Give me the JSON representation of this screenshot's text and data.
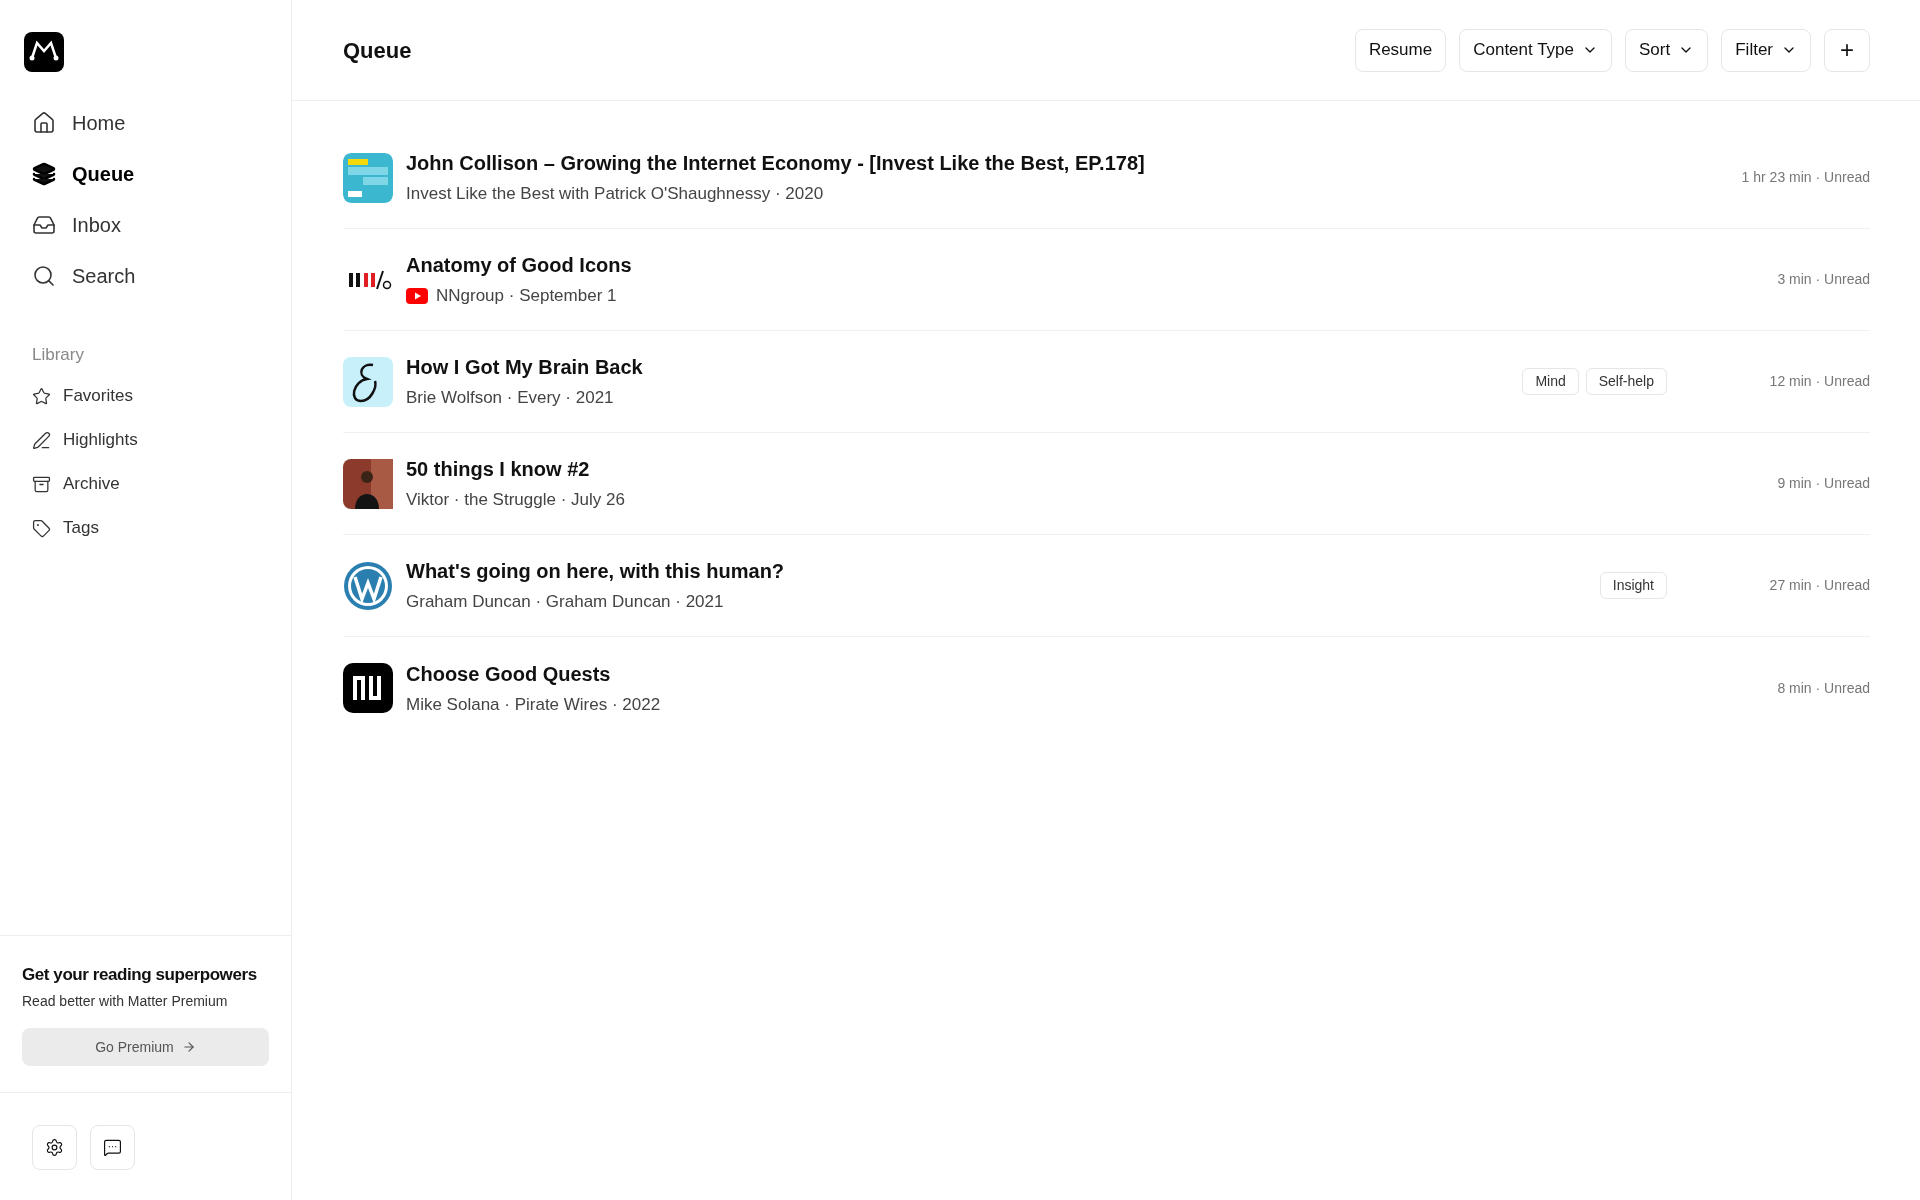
{
  "nav": [
    {
      "label": "Home",
      "selected": false
    },
    {
      "label": "Queue",
      "selected": true
    },
    {
      "label": "Inbox",
      "selected": false
    },
    {
      "label": "Search",
      "selected": false
    }
  ],
  "library": {
    "heading": "Library",
    "items": [
      "Favorites",
      "Highlights",
      "Archive",
      "Tags"
    ]
  },
  "promo": {
    "title": "Get your reading superpowers",
    "text": "Read better with Matter Premium",
    "button": "Go Premium"
  },
  "header": {
    "title": "Queue",
    "buttons": [
      {
        "label": "Resume",
        "kind": "plain"
      },
      {
        "label": "Content Type",
        "kind": "dropdown"
      },
      {
        "label": "Sort",
        "kind": "dropdown"
      },
      {
        "label": "Filter",
        "kind": "dropdown"
      },
      {
        "label": "+",
        "kind": "icon"
      }
    ]
  },
  "rows": [
    {
      "kind": "cover",
      "title": "John Collison – Growing the Internet Economy - [Invest Like the Best, EP.178]",
      "video": false,
      "subtitle": "Invest Like the Best with Patrick O'Shaughnessy · 2020",
      "tags": [],
      "meta": "1 hr 23 min · Unread"
    },
    {
      "kind": "bars",
      "title": "Anatomy of Good Icons",
      "video": true,
      "subtitle": "NNgroup · September 1",
      "tags": [],
      "meta": "3 min · Unread"
    },
    {
      "kind": "script",
      "title": "How I Got My Brain Back",
      "video": false,
      "subtitle": "Brie Wolfson · Every · 2021",
      "tags": [
        "Mind",
        "Self-help"
      ],
      "meta": "12 min · Unread"
    },
    {
      "title": "50 things I know #2",
      "video": false,
      "subtitle": "Viktor · the Struggle · July 26",
      "tags": [],
      "meta": "9 min · Unread"
    },
    {
      "kind": "circle",
      "title": "What's going on here, with this human?",
      "video": false,
      "subtitle": "Graham Duncan · Graham Duncan · 2021",
      "tags": [
        "Insight"
      ],
      "meta": "27 min · Unread"
    },
    {
      "kind": "badge",
      "title": "Choose Good Quests",
      "video": false,
      "subtitle": "Mike Solana · Pirate Wires · 2022",
      "tags": [],
      "meta": "8 min · Unread"
    }
  ]
}
